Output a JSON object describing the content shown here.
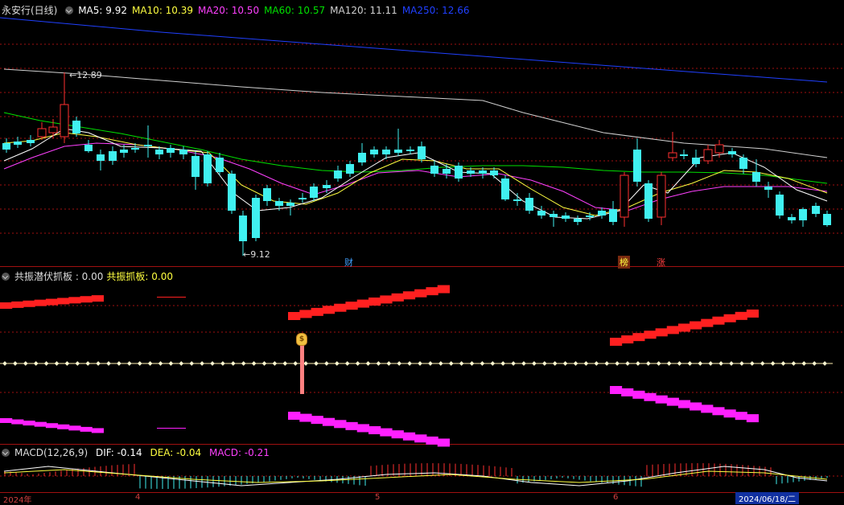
{
  "main_chart": {
    "title": "永安行(日线)",
    "ma_labels": [
      {
        "text": "MA5: 9.92",
        "color": "#ffffff"
      },
      {
        "text": "MA10: 10.39",
        "color": "#ffff40"
      },
      {
        "text": "MA20: 10.50",
        "color": "#ff40ff"
      },
      {
        "text": "MA60: 10.57",
        "color": "#00e000"
      },
      {
        "text": "MA120: 11.11",
        "color": "#d0d0d0"
      },
      {
        "text": "MA250: 12.66",
        "color": "#2040ff"
      }
    ],
    "high_label": "12.89",
    "low_label": "9.12",
    "events": [
      {
        "text": "财",
        "color": "#40a0ff",
        "bg": "#000"
      },
      {
        "text": "榜",
        "color": "#ffff40",
        "bg": "#7a2a10"
      },
      {
        "text": "涨",
        "color": "#ff4040",
        "bg": "#000"
      }
    ]
  },
  "indicator_panel": {
    "name": "共振潜伏抓板 : 0.00",
    "sub_label": "共振抓板: 0.00",
    "signal_icon": "money-bag-icon"
  },
  "macd_panel": {
    "name": "MACD(12,26,9)",
    "dif": "DIF: -0.14",
    "dea": "DEA: -0.04",
    "macd": "MACD: -0.21"
  },
  "date_axis": {
    "labels": [
      "2024年",
      "4",
      "5",
      "6"
    ],
    "current_date": "2024/06/18/二"
  },
  "colors": {
    "up": "#ff3030",
    "down": "#40f0f0",
    "grid": "#a01010"
  }
}
